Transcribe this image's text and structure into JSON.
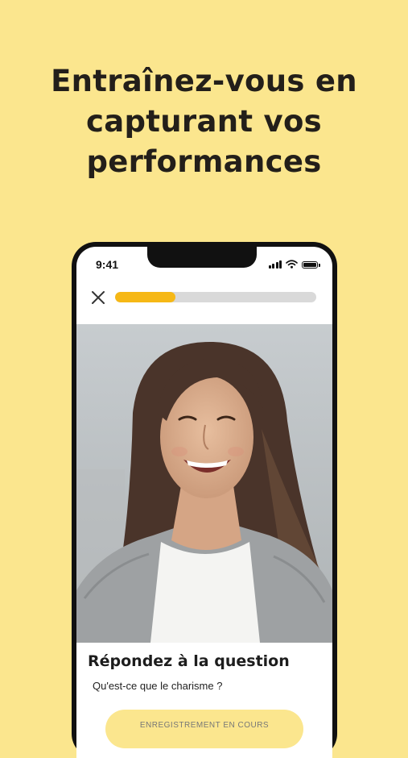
{
  "headline": {
    "line1": "Entraînez-vous en",
    "line2": "capturant vos",
    "line3": "performances"
  },
  "phone": {
    "status_bar": {
      "time": "9:41",
      "icons": [
        "signal-icon",
        "wifi-icon",
        "battery-icon"
      ]
    },
    "close_icon": "close-icon",
    "progress": 0.3,
    "video": {
      "description": "video-feed"
    },
    "question": {
      "title": "Répondez à la question",
      "text": "Qu'est-ce que le charisme ?"
    },
    "record_button_label": "ENREGISTREMENT EN COURS"
  },
  "colors": {
    "background": "#FBE68E",
    "accent": "#F6B816",
    "track": "#D9D9D9",
    "text_dark": "#231F1A"
  }
}
